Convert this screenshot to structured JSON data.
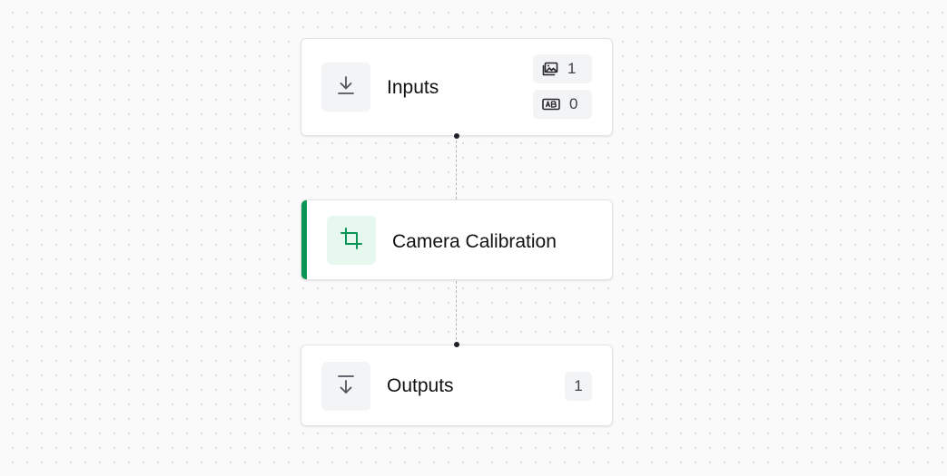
{
  "workflow": {
    "nodes": {
      "inputs": {
        "label": "Inputs",
        "icon": "download-icon",
        "image_count": "1",
        "text_count": "0",
        "image_icon": "image-icon",
        "text_icon": "text-field-icon"
      },
      "step": {
        "label": "Camera Calibration",
        "icon": "crop-icon",
        "accent_color": "#079455",
        "icon_bg": "#e7f8ef"
      },
      "outputs": {
        "label": "Outputs",
        "icon": "output-arrow-icon",
        "count": "1"
      }
    }
  }
}
